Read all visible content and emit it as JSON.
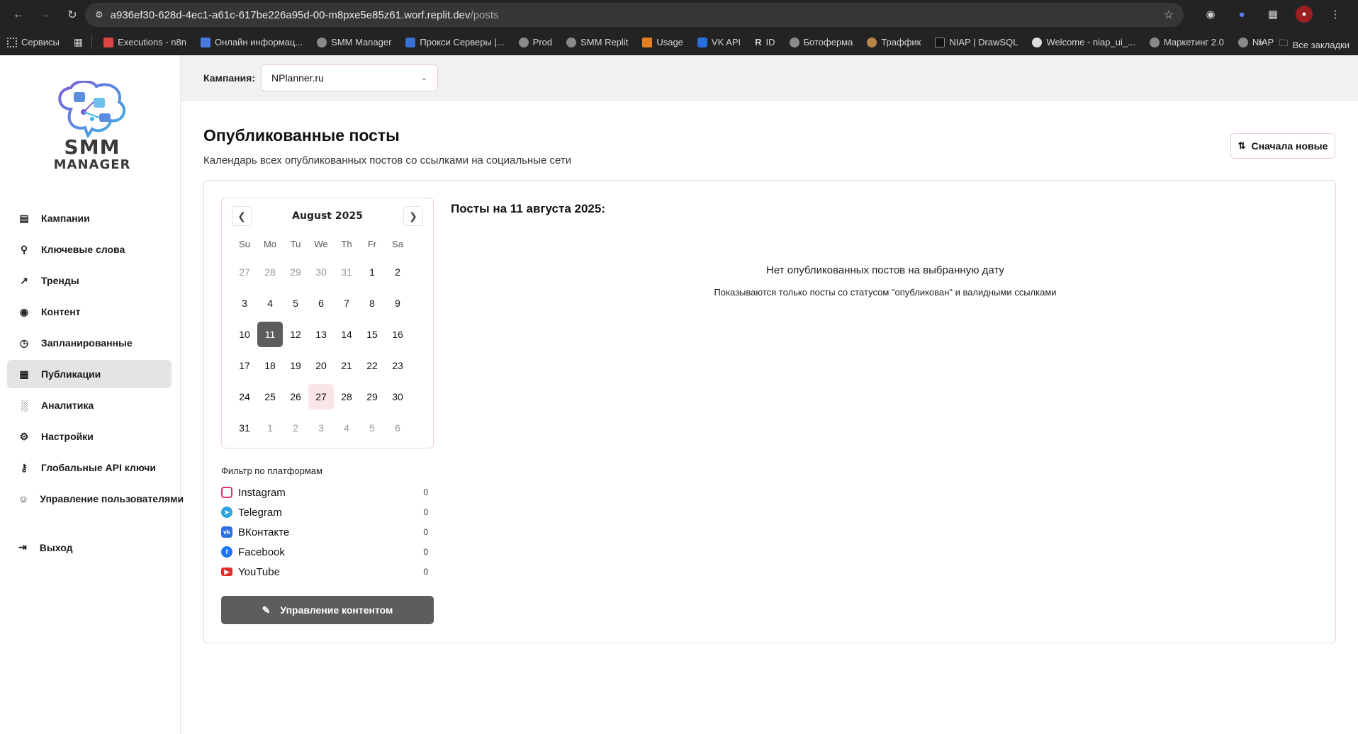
{
  "browser": {
    "url_host": "a936ef30-628d-4ec1-a61c-617be226a95d-00-m8pxe5e85z61.worf.replit.dev",
    "url_path": "/posts",
    "bookmarks": [
      "Сервисы",
      "Executions - n8n",
      "Онлайн информац...",
      "SMM Manager",
      "Прокси Серверы |...",
      "Prod",
      "SMM Replit",
      "Usage",
      "VK API",
      "ID",
      "Ботоферма",
      "Траффик",
      "NIAP | DrawSQL",
      "Welcome - niap_ui_...",
      "Маркетинг 2.0",
      "NIAP"
    ],
    "all_bookmarks": "Все закладки"
  },
  "logo": {
    "line1": "SMM",
    "line2": "MANAGER"
  },
  "sidebar": {
    "items": [
      {
        "label": "Кампании",
        "icon": "file-icon"
      },
      {
        "label": "Ключевые слова",
        "icon": "search-icon"
      },
      {
        "label": "Тренды",
        "icon": "trend-icon"
      },
      {
        "label": "Контент",
        "icon": "tag-icon"
      },
      {
        "label": "Запланированные",
        "icon": "clock-icon"
      },
      {
        "label": "Публикации",
        "icon": "calendar-icon"
      },
      {
        "label": "Аналитика",
        "icon": "bar-chart-icon"
      },
      {
        "label": "Настройки",
        "icon": "gear-icon"
      },
      {
        "label": "Глобальные API ключи",
        "icon": "key-icon"
      },
      {
        "label": "Управление пользователями",
        "icon": "users-icon"
      }
    ],
    "active": "Публикации",
    "logout": "Выход"
  },
  "campaign": {
    "label": "Кампания:",
    "selected": "NPlanner.ru"
  },
  "page": {
    "title": "Опубликованные посты",
    "subtitle": "Календарь всех опубликованных постов со ссылками на социальные сети",
    "sort_label": "Сначала новые"
  },
  "calendar": {
    "month": "August 2025",
    "weekdays": [
      "Su",
      "Mo",
      "Tu",
      "We",
      "Th",
      "Fr",
      "Sa"
    ],
    "weeks": [
      [
        "27",
        "28",
        "29",
        "30",
        "31",
        "1",
        "2"
      ],
      [
        "3",
        "4",
        "5",
        "6",
        "7",
        "8",
        "9"
      ],
      [
        "10",
        "11",
        "12",
        "13",
        "14",
        "15",
        "16"
      ],
      [
        "17",
        "18",
        "19",
        "20",
        "21",
        "22",
        "23"
      ],
      [
        "24",
        "25",
        "26",
        "27",
        "28",
        "29",
        "30"
      ],
      [
        "31",
        "1",
        "2",
        "3",
        "4",
        "5",
        "6"
      ]
    ],
    "selected_day": "11",
    "today_day": "27"
  },
  "filter": {
    "title": "Фильтр по платформам",
    "platforms": [
      {
        "name": "Instagram",
        "count": "0",
        "color": "#e1306c"
      },
      {
        "name": "Telegram",
        "count": "0",
        "color": "#2aa3e0"
      },
      {
        "name": "ВКонтакте",
        "count": "0",
        "color": "#2a6fe0"
      },
      {
        "name": "Facebook",
        "count": "0",
        "color": "#1877f2"
      },
      {
        "name": "YouTube",
        "count": "0",
        "color": "#e52d27"
      }
    ]
  },
  "manage_button": "Управление контентом",
  "posts": {
    "heading": "Посты на 11 августа 2025:",
    "empty_title": "Нет опубликованных постов на выбранную дату",
    "empty_sub": "Показываются только посты со статусом \"опубликован\" и валидными ссылками"
  }
}
